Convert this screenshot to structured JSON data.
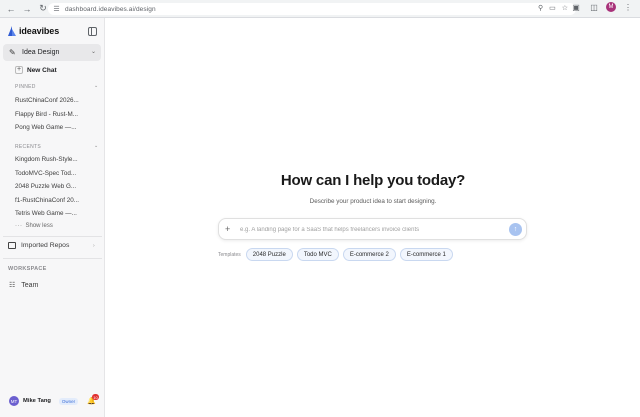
{
  "browser": {
    "url": "dashboard.ideavibes.ai/design",
    "profile_initial": "M"
  },
  "sidebar": {
    "brand": "ideavibes",
    "project_selector": "Idea Design",
    "new_chat": "New Chat",
    "pinned_heading": "PINNED",
    "pinned": [
      "RustChinaConf 2026...",
      "Flappy Bird - Rust-M...",
      "Pong Web Game —..."
    ],
    "recents_heading": "RECENTS",
    "recents": [
      "Kingdom Rush-Style...",
      "TodoMVC-Spec Tod...",
      "2048 Puzzle Web G...",
      "f1-RustChinaConf 20...",
      "Tetris Web Game —..."
    ],
    "show_less": "Show less",
    "imported_repos": "Imported Repos",
    "workspace_heading": "WORKSPACE",
    "team": "Team",
    "user": {
      "initials": "MT",
      "name": "Mike Tang",
      "role": "Owner",
      "notifications": "10"
    }
  },
  "main": {
    "headline": "How can I help you today?",
    "subtitle": "Describe your product idea to start designing.",
    "prompt_placeholder": "e.g. A landing page for a SaaS that helps freelancers invoice clients",
    "templates_label": "Templates",
    "templates": [
      "2048 Puzzle",
      "Todo MVC",
      "E-commerce 2",
      "E-commerce 1"
    ]
  },
  "colors": {
    "accent": "#3b6ed8",
    "send_button": "#a8c3f0",
    "chip_border": "#c9d8f0",
    "notification": "#e02f2f"
  }
}
